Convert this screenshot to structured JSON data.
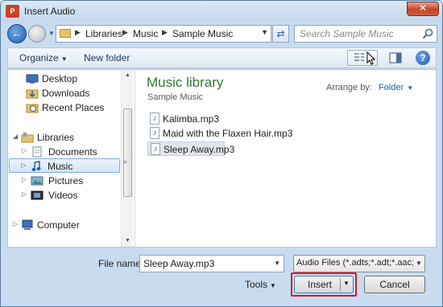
{
  "window": {
    "title": "Insert Audio",
    "app_badge": "P",
    "close_label": "✕"
  },
  "address": {
    "crumbs": [
      "Libraries",
      "Music",
      "Sample Music"
    ],
    "search_placeholder": "Search Sample Music"
  },
  "toolbar": {
    "organize": "Organize",
    "new_folder": "New folder",
    "help": "?"
  },
  "nav": {
    "items": [
      {
        "label": "Desktop",
        "icon": "desktop-icon"
      },
      {
        "label": "Downloads",
        "icon": "downloads-folder-icon"
      },
      {
        "label": "Recent Places",
        "icon": "recent-places-icon"
      },
      {
        "label": "Libraries",
        "icon": "libraries-icon"
      },
      {
        "label": "Documents",
        "icon": "documents-icon"
      },
      {
        "label": "Music",
        "icon": "music-icon"
      },
      {
        "label": "Pictures",
        "icon": "pictures-icon"
      },
      {
        "label": "Videos",
        "icon": "videos-icon"
      },
      {
        "label": "Computer",
        "icon": "computer-icon"
      }
    ]
  },
  "library": {
    "title": "Music library",
    "subtitle": "Sample Music",
    "arrange_label": "Arrange by:",
    "arrange_value": "Folder"
  },
  "files": [
    {
      "name": "Kalimba.mp3"
    },
    {
      "name": "Maid with the Flaxen Hair.mp3"
    },
    {
      "name": "Sleep Away.mp3"
    }
  ],
  "bottom": {
    "file_name_label": "File name:",
    "file_name_value": "Sleep Away.mp3",
    "file_type_value": "Audio Files (*.adts;*.adt;*.aac;*.",
    "tools_label": "Tools",
    "insert_label": "Insert",
    "cancel_label": "Cancel"
  },
  "colors": {
    "accent": "#1f5fb0",
    "library_title": "#2e7a2e",
    "highlight_ring": "#d7172a"
  }
}
